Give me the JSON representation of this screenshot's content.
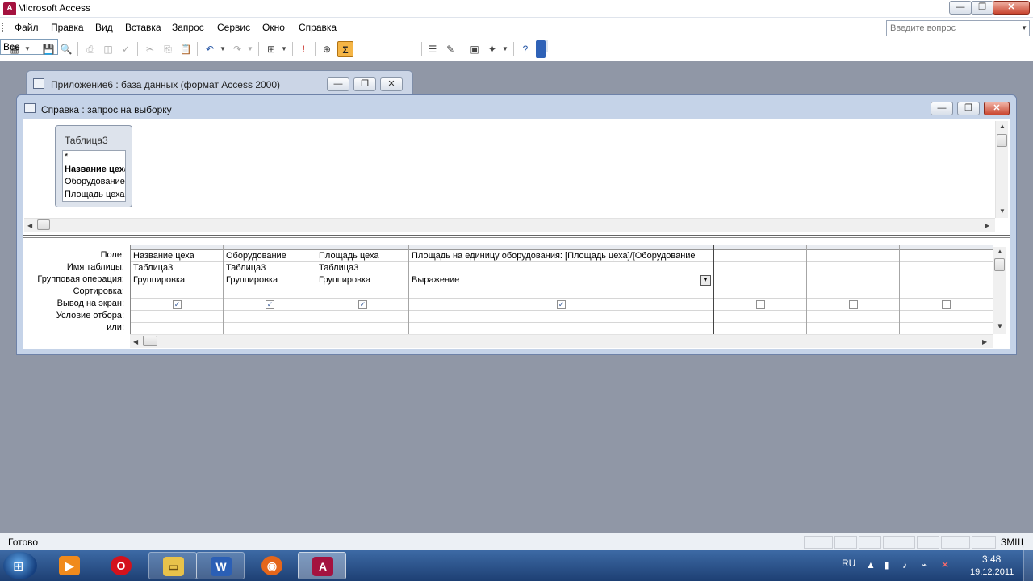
{
  "app": {
    "title": "Microsoft Access",
    "icon": "access-icon"
  },
  "menu": {
    "items": [
      "Файл",
      "Правка",
      "Вид",
      "Вставка",
      "Запрос",
      "Сервис",
      "Окно",
      "Справка"
    ]
  },
  "help_search": {
    "placeholder": "Введите вопрос"
  },
  "toolbar": {
    "combo_value": "Все",
    "sigma_label": "Σ"
  },
  "db_window": {
    "title": "Приложение6 : база данных (формат Access 2000)"
  },
  "query_window": {
    "title": "Справка : запрос на выборку"
  },
  "table_list": {
    "name": "Таблица3",
    "fields": [
      "*",
      "Название цеха",
      "Оборудование",
      "Площадь цеха"
    ]
  },
  "grid": {
    "row_labels": [
      "Поле:",
      "Имя таблицы:",
      "Групповая операция:",
      "Сортировка:",
      "Вывод на экран:",
      "Условие отбора:",
      "или:"
    ],
    "columns": [
      {
        "field": "Название цеха",
        "table": "Таблица3",
        "group": "Группировка",
        "show": true
      },
      {
        "field": "Оборудование",
        "table": "Таблица3",
        "group": "Группировка",
        "show": true
      },
      {
        "field": "Площадь цеха",
        "table": "Таблица3",
        "group": "Группировка",
        "show": true
      },
      {
        "field": "Площадь на единицу оборудования: [Площадь цеха]/[Оборудование",
        "table": "",
        "group": "Выражение",
        "show": true
      },
      {
        "field": "",
        "table": "",
        "group": "",
        "show": false
      },
      {
        "field": "",
        "table": "",
        "group": "",
        "show": false
      },
      {
        "field": "",
        "table": "",
        "group": "",
        "show": false
      }
    ]
  },
  "status": {
    "text": "Готово",
    "mode": "ЗМЩ"
  },
  "taskbar": {
    "lang": "RU",
    "time": "3:48",
    "date": "19.12.2011",
    "apps": [
      "media-player",
      "opera",
      "explorer",
      "word",
      "firefox",
      "access"
    ]
  }
}
